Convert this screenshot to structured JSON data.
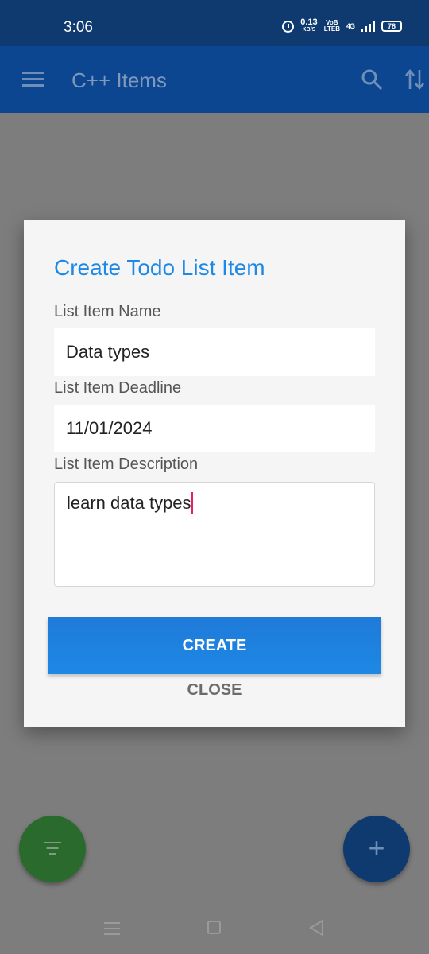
{
  "status_bar": {
    "time": "3:06",
    "speed_value": "0.13",
    "speed_unit": "KB/S",
    "volte_top": "VoB",
    "volte_bottom": "LTEB",
    "network": "4G",
    "battery": "78"
  },
  "app_bar": {
    "title": "C++ Items"
  },
  "dialog": {
    "title": "Create Todo List Item",
    "name_label": "List Item Name",
    "name_value": "Data types",
    "deadline_label": "List Item Deadline",
    "deadline_value": "11/01/2024",
    "description_label": "List Item Description",
    "description_value": "learn data types",
    "create_label": "CREATE",
    "close_label": "CLOSE"
  },
  "fab": {
    "add_symbol": "+"
  },
  "colors": {
    "accent": "#1e88e5",
    "app_bar": "#0d4690",
    "status_bar": "#0e3a70",
    "filter_fab": "#2a6b2d",
    "cursor": "#e91e63"
  }
}
